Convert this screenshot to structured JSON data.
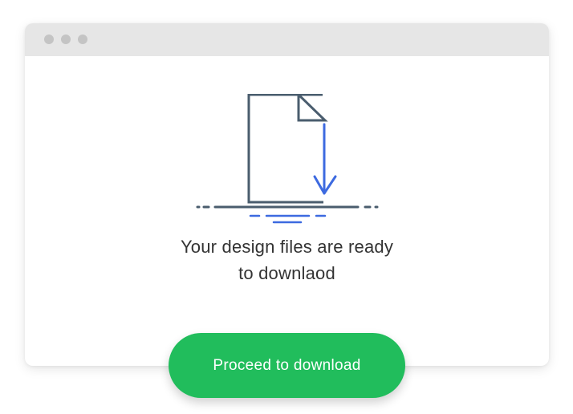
{
  "window": {
    "controls": [
      "window-dot",
      "window-dot",
      "window-dot"
    ]
  },
  "illustration": {
    "icon": "file-download-icon",
    "colors": {
      "outline": "#4a5d6e",
      "accent": "#3d6ae0"
    }
  },
  "message": {
    "line1": "Your design files are ready",
    "line2": "to downlaod"
  },
  "cta": {
    "label": "Proceed to download",
    "color": "#21bd5c"
  }
}
